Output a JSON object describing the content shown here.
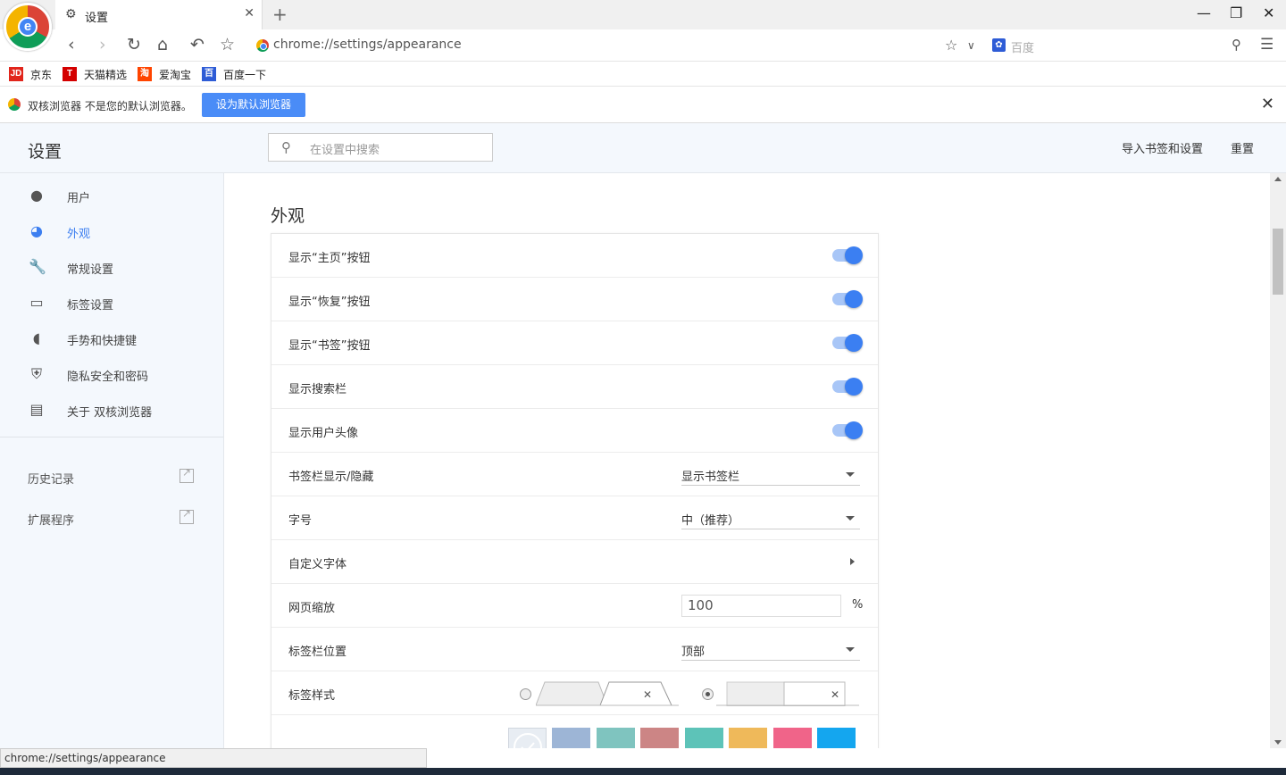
{
  "browser": {
    "tab_title": "设置",
    "url": "chrome://settings/appearance",
    "search_engine": "百度",
    "logo_letter": "e"
  },
  "bookmarks": [
    {
      "label": "京东",
      "icon": "JD",
      "color": "#e1251b"
    },
    {
      "label": "天猫精选",
      "icon": "T",
      "color": "#d40000"
    },
    {
      "label": "爱淘宝",
      "icon": "淘",
      "color": "#ff4400"
    },
    {
      "label": "百度一下",
      "icon": "百",
      "color": "#2e5cd6"
    }
  ],
  "notice": {
    "text": "双核浏览器 不是您的默认浏览器。",
    "button": "设为默认浏览器"
  },
  "header": {
    "title": "设置",
    "search_placeholder": "在设置中搜索",
    "import_link": "导入书签和设置",
    "reset_link": "重置"
  },
  "sidebar": {
    "items": [
      {
        "label": "用户",
        "icon": "person-icon"
      },
      {
        "label": "外观",
        "icon": "palette-icon",
        "active": true
      },
      {
        "label": "常规设置",
        "icon": "wrench-icon"
      },
      {
        "label": "标签设置",
        "icon": "tab-icon"
      },
      {
        "label": "手势和快捷键",
        "icon": "mouse-icon"
      },
      {
        "label": "隐私安全和密码",
        "icon": "shield-icon"
      },
      {
        "label": "关于 双核浏览器",
        "icon": "clipboard-icon"
      }
    ],
    "links": [
      {
        "label": "历史记录",
        "icon": "external-link-icon"
      },
      {
        "label": "扩展程序",
        "icon": "external-link-icon"
      }
    ]
  },
  "main": {
    "section_title": "外观",
    "rows": [
      {
        "label": "显示“主页”按钮",
        "type": "toggle",
        "on": true
      },
      {
        "label": "显示“恢复”按钮",
        "type": "toggle",
        "on": true
      },
      {
        "label": "显示“书签”按钮",
        "type": "toggle",
        "on": true
      },
      {
        "label": "显示搜索栏",
        "type": "toggle",
        "on": true
      },
      {
        "label": "显示用户头像",
        "type": "toggle",
        "on": true
      },
      {
        "label": "书签栏显示/隐藏",
        "type": "select",
        "value": "显示书签栏"
      },
      {
        "label": "字号",
        "type": "select",
        "value": "中（推荐）"
      },
      {
        "label": "自定义字体",
        "type": "link"
      },
      {
        "label": "网页缩放",
        "type": "input",
        "value": "100",
        "unit": "%"
      },
      {
        "label": "标签栏位置",
        "type": "select",
        "value": "顶部"
      },
      {
        "label": "标签样式",
        "type": "radio",
        "selected": 1
      }
    ],
    "theme_colors": [
      "#e8edf3",
      "#9db5d6",
      "#7fc4bf",
      "#cc8585",
      "#5dc3b8",
      "#efb95a",
      "#f06489",
      "#14a6ef"
    ]
  },
  "status_text": "chrome://settings/appearance"
}
